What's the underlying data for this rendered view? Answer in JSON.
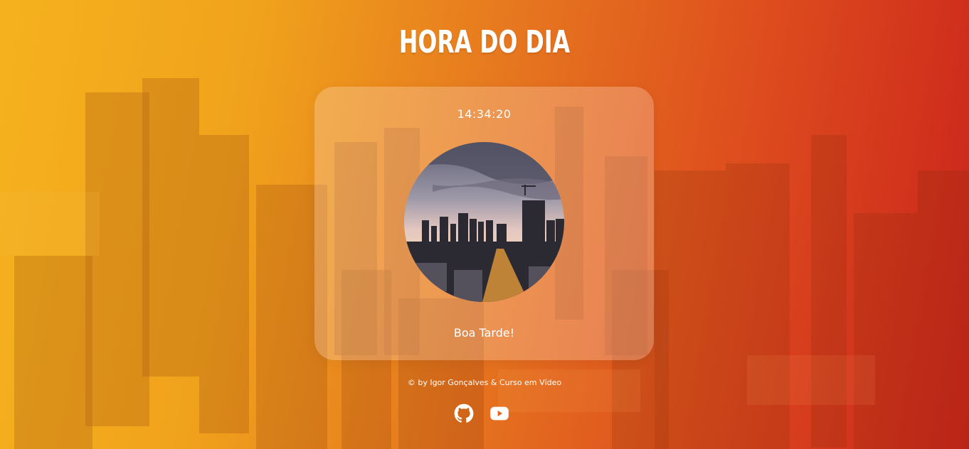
{
  "page": {
    "title": "HORA DO DIA"
  },
  "clock": {
    "time": "14:34:20"
  },
  "greeting": {
    "text": "Boa Tarde!"
  },
  "footer": {
    "copyright": "© by Igor Gonçalves & Curso em Vídeo"
  },
  "social": {
    "icons": [
      "github-icon",
      "youtube-icon"
    ]
  },
  "colors": {
    "gradient_start": "#f6b21e",
    "gradient_end": "#c9231b",
    "text": "#ffffff"
  }
}
